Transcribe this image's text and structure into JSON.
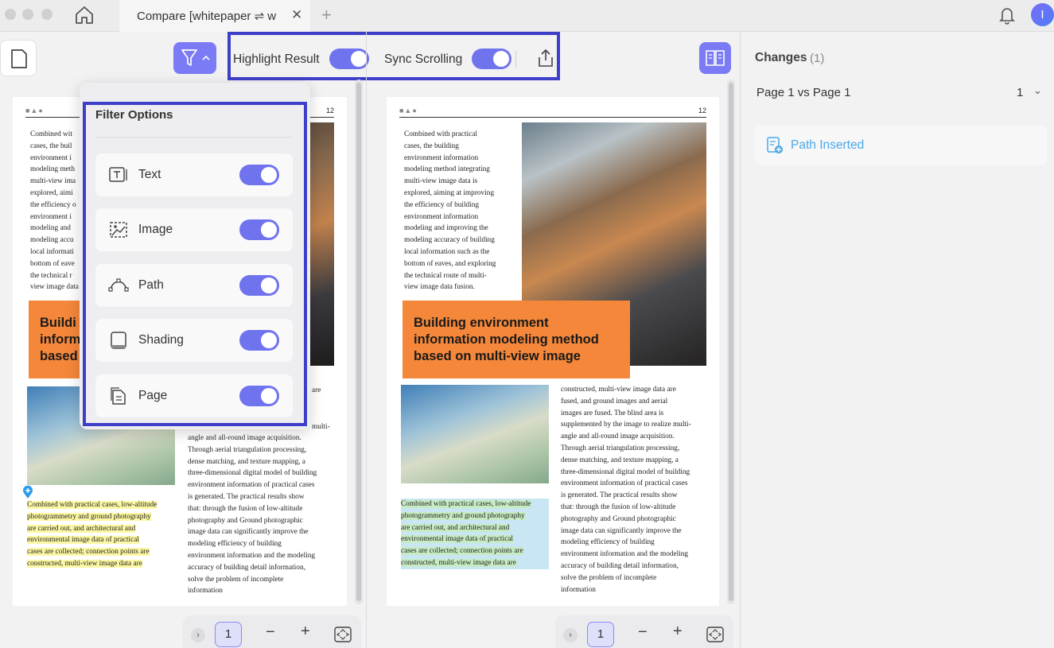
{
  "tab": {
    "title": "Compare [whitepaper ⇌ w",
    "close": "✕",
    "new_tab": "+"
  },
  "avatar_initial": "I",
  "toolbar": {
    "highlight_label": "Highlight Result",
    "sync_label": "Sync Scrolling",
    "highlight_on": true,
    "sync_on": true
  },
  "filter": {
    "title": "Filter Options",
    "options": [
      {
        "label": "Text",
        "icon": "text-icon",
        "on": true
      },
      {
        "label": "Image",
        "icon": "image-icon",
        "on": true
      },
      {
        "label": "Path",
        "icon": "path-icon",
        "on": true
      },
      {
        "label": "Shading",
        "icon": "shading-icon",
        "on": true
      },
      {
        "label": "Page",
        "icon": "page-icon",
        "on": true
      }
    ]
  },
  "document": {
    "page_number": "12",
    "shapes": "■▲●",
    "intro_lines": [
      "Combined with practical",
      "cases, the building",
      "environment information",
      "modeling method integrating",
      "multi-view image data is",
      "explored, aiming at improving",
      "the efficiency of building",
      "environment information",
      "modeling and improving the",
      "modeling accuracy of building",
      "local information such as the",
      "bottom of eaves, and exploring",
      "the technical route of multi-",
      "view image data fusion."
    ],
    "left_intro_lines": [
      "Combined wit",
      "cases, the buil",
      "environment i",
      "modeling meth",
      "multi-view ima",
      "explored, aimi",
      "the efficiency o",
      "environment i",
      "modeling and",
      "modeling accu",
      "local informati",
      "bottom of eave",
      "the technical r",
      "view image data"
    ],
    "heading_lines": [
      "Building environment",
      "information modeling method",
      "based on multi-view image"
    ],
    "left_heading_lines": [
      "Buildi",
      "inform",
      "based"
    ],
    "body_lines": [
      "constructed, multi-view image data are",
      "fused, and ground images and aerial",
      "images are fused. The blind area is",
      "supplemented by the image to realize multi-",
      "angle and all-round image acquisition.",
      "Through aerial triangulation processing,",
      "dense matching, and texture mapping, a",
      "three-dimensional digital model of building",
      "environment information of practical cases",
      "is generated. The practical results show",
      "that: through the fusion of low-altitude",
      "photography and Ground photographic",
      "image data can significantly improve the",
      "modeling efficiency of building",
      "environment information and the modeling",
      "accuracy of building detail information,",
      "solve the problem of incomplete",
      "information"
    ],
    "highlight_lines": [
      "Combined with practical cases, low-altitude",
      "photogrammetry and ground photography",
      "are carried out, and architectural and",
      "environmental image data of practical",
      "cases are collected; connection points are",
      "constructed, multi-view image data are"
    ],
    "left_body_fragment_1": "are",
    "left_body_fragment_2": "multi-"
  },
  "bottom_bar": {
    "page": "1",
    "minus": "−",
    "plus": "+"
  },
  "sidebar": {
    "changes_title": "Changes",
    "changes_count": "(1)",
    "page_vs": "Page 1 vs Page 1",
    "page_vs_num": "1",
    "change_item": "Path Inserted"
  },
  "colors": {
    "accent": "#7073ee",
    "frame": "#3d3fc9",
    "orange": "#f5873a",
    "change_blue": "#4aa8e8"
  }
}
